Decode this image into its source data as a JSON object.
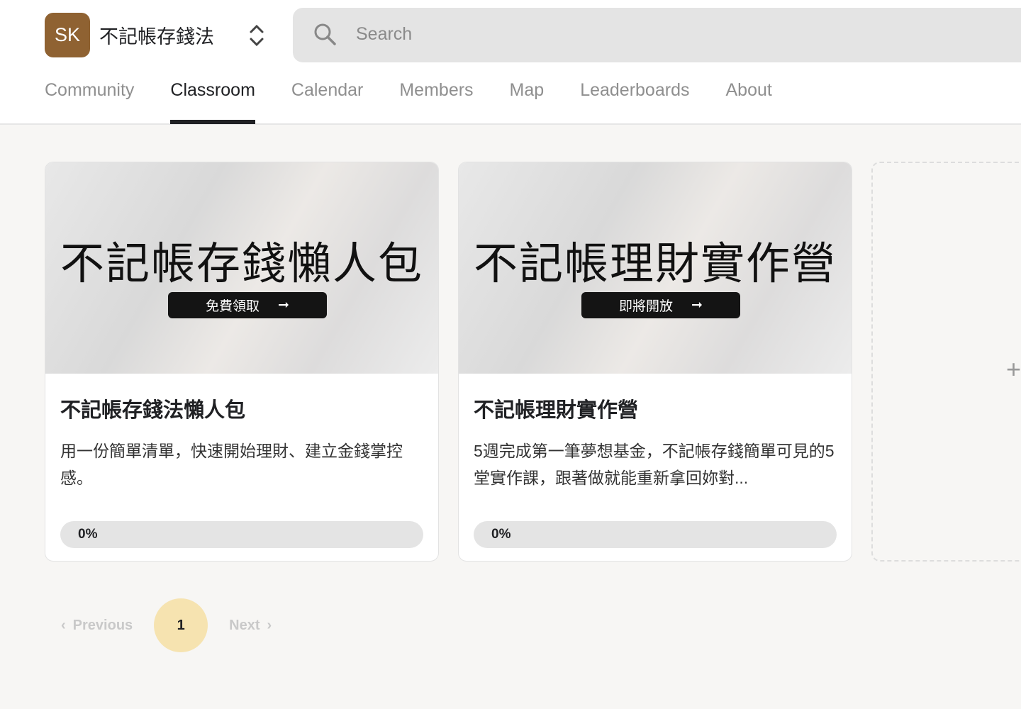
{
  "header": {
    "logo_initials": "SK",
    "group_name": "不記帳存錢法",
    "search_placeholder": "Search",
    "brand_color": "#8f6232"
  },
  "tabs": [
    {
      "label": "Community"
    },
    {
      "label": "Classroom",
      "active": true
    },
    {
      "label": "Calendar"
    },
    {
      "label": "Members"
    },
    {
      "label": "Map"
    },
    {
      "label": "Leaderboards"
    },
    {
      "label": "About"
    }
  ],
  "courses": [
    {
      "cover_title": "不記帳存錢懶人包",
      "cover_button": "免費領取",
      "title": "不記帳存錢法懶人包",
      "description": "用一份簡單清單，快速開始理財、建立金錢掌控感。",
      "progress": "0%"
    },
    {
      "cover_title": "不記帳理財實作營",
      "cover_button": "即將開放",
      "title": "不記帳理財實作營",
      "description": "5週完成第一筆夢想基金，不記帳存錢簡單可見的5堂實作課，跟著做就能重新拿回妳對...",
      "progress": "0%"
    }
  ],
  "add_course": {
    "icon": "plus-icon"
  },
  "pagination": {
    "previous": "Previous",
    "current": "1",
    "next": "Next",
    "current_color": "#f6e3b0"
  }
}
